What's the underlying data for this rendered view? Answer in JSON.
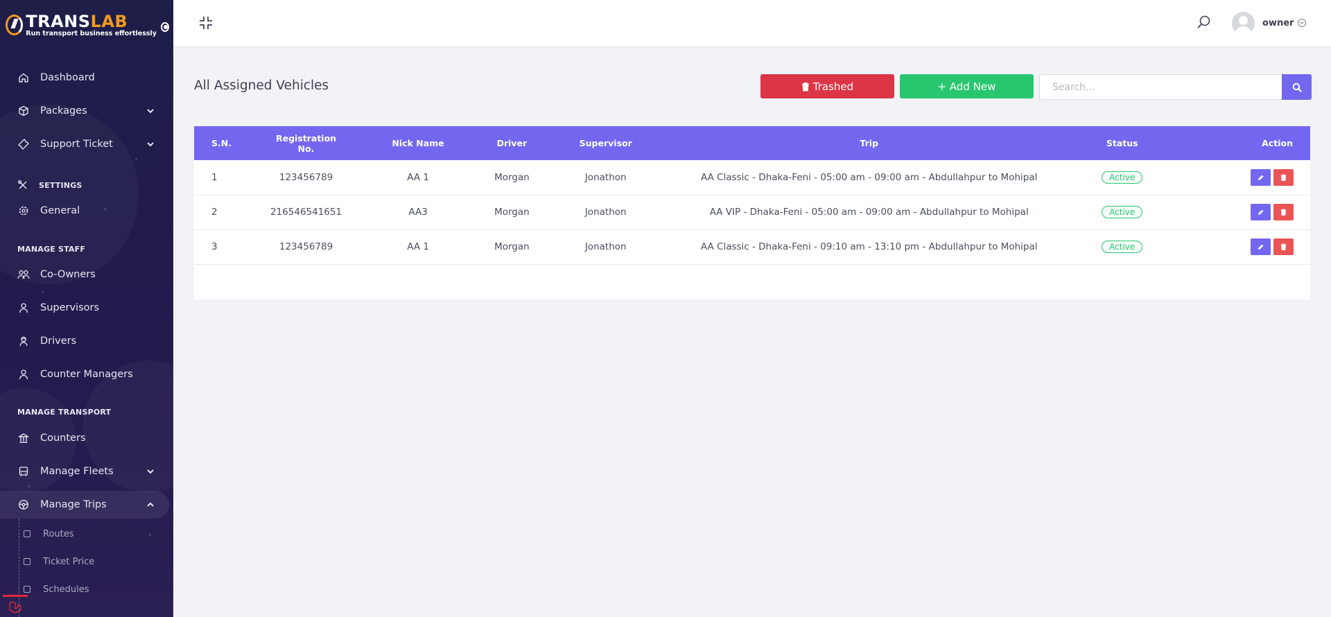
{
  "brand": {
    "name_part1": "TRANS",
    "name_part2": "LAB",
    "tagline": "Run transport business effortlessly"
  },
  "sidebar": {
    "items": [
      {
        "label": "Dashboard",
        "icon": "home-icon"
      },
      {
        "label": "Packages",
        "icon": "box-icon"
      },
      {
        "label": "Support Ticket",
        "icon": "ticket-icon"
      },
      {
        "label": "General",
        "icon": "gear-icon"
      },
      {
        "label": "Co-Owners",
        "icon": "users-icon"
      },
      {
        "label": "Supervisors",
        "icon": "user-icon"
      },
      {
        "label": "Drivers",
        "icon": "driver-icon"
      },
      {
        "label": "Counter Managers",
        "icon": "user-icon"
      },
      {
        "label": "Counters",
        "icon": "bank-icon"
      },
      {
        "label": "Manage Fleets",
        "icon": "bus-icon"
      },
      {
        "label": "Manage Trips",
        "icon": "steering-wheel-icon"
      }
    ],
    "sections": {
      "settings": "SETTINGS",
      "manage_staff": "MANAGE STAFF",
      "manage_transport": "MANAGE TRANSPORT"
    },
    "sub_items": [
      "Routes",
      "Ticket Price",
      "Schedules"
    ]
  },
  "header": {
    "user_name": "owner"
  },
  "main": {
    "title": "All Assigned Vehicles",
    "trashed_label": "Trashed",
    "add_label": "+ Add New",
    "search_placeholder": "Search..."
  },
  "table": {
    "headers": [
      "S.N.",
      "Registration No.",
      "Nick Name",
      "Driver",
      "Supervisor",
      "Trip",
      "Status",
      "Action"
    ],
    "rows": [
      {
        "sn": "1",
        "reg": "123456789",
        "nick": "AA 1",
        "driver": "Morgan",
        "supervisor": "Jonathon",
        "trip": "AA Classic - Dhaka-Feni - 05:00 am - 09:00 am - Abdullahpur to Mohipal",
        "status": "Active"
      },
      {
        "sn": "2",
        "reg": "216546541651",
        "nick": "AA3",
        "driver": "Morgan",
        "supervisor": "Jonathon",
        "trip": "AA VIP - Dhaka-Feni - 05:00 am - 09:00 am - Abdullahpur to Mohipal",
        "status": "Active"
      },
      {
        "sn": "3",
        "reg": "123456789",
        "nick": "AA 1",
        "driver": "Morgan",
        "supervisor": "Jonathon",
        "trip": "AA Classic - Dhaka-Feni - 09:10 am - 13:10 pm - Abdullahpur to Mohipal",
        "status": "Active"
      }
    ]
  },
  "colors": {
    "primary": "#7367f0",
    "danger": "#dc3545",
    "success": "#28c76f",
    "sidebar_bg": "#1e1e49",
    "brand_accent": "#f29a1e"
  }
}
